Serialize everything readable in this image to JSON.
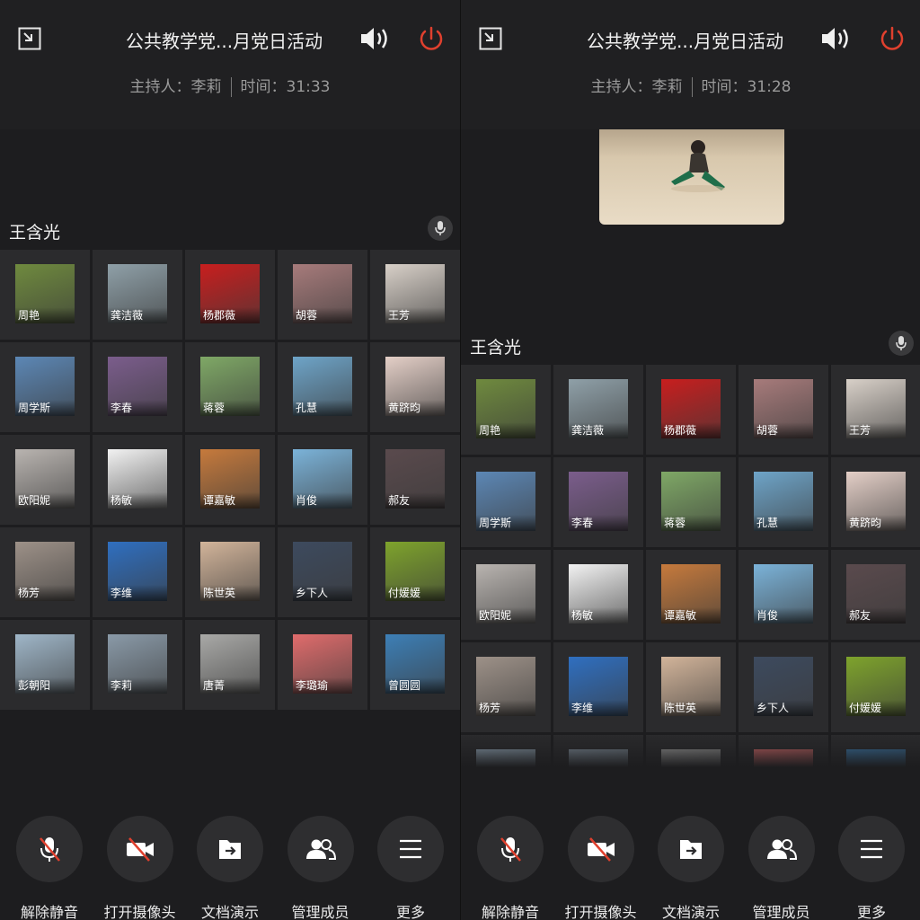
{
  "panels": [
    {
      "title": "公共教学党...月党日活动",
      "host_label": "主持人：李莉",
      "time_label": "时间：31:33",
      "speaker_name": "王含光"
    },
    {
      "title": "公共教学党...月党日活动",
      "host_label": "主持人：李莉",
      "time_label": "时间：31:28",
      "speaker_name": "王含光"
    }
  ],
  "participants": [
    {
      "name": "周艳",
      "bg": "#6f8a3e"
    },
    {
      "name": "龚洁薇",
      "bg": "#8fa0a8"
    },
    {
      "name": "杨郡薇",
      "bg": "#c81e1e"
    },
    {
      "name": "胡蓉",
      "bg": "#a77b7b"
    },
    {
      "name": "王芳",
      "bg": "#d8d0c8"
    },
    {
      "name": "周学斯",
      "bg": "#5c87b5"
    },
    {
      "name": "李春",
      "bg": "#7b5d8c"
    },
    {
      "name": "蒋蓉",
      "bg": "#7fa866"
    },
    {
      "name": "孔慧",
      "bg": "#6ea4c8"
    },
    {
      "name": "黄跻昀",
      "bg": "#e4cfc7"
    },
    {
      "name": "欧阳妮",
      "bg": "#b9b4b0"
    },
    {
      "name": "杨敏",
      "bg": "#f2f2f2"
    },
    {
      "name": "谭嘉敏",
      "bg": "#c67a3c"
    },
    {
      "name": "肖俊",
      "bg": "#7bb3d9"
    },
    {
      "name": "郝友",
      "bg": "#5a4a4d"
    },
    {
      "name": "杨芳",
      "bg": "#9d9188"
    },
    {
      "name": "李维",
      "bg": "#2f6fc0"
    },
    {
      "name": "陈世英",
      "bg": "#d2b49a"
    },
    {
      "name": "乡下人",
      "bg": "#3d4a5e"
    },
    {
      "name": "付媛媛",
      "bg": "#7ea32c"
    },
    {
      "name": "彭朝阳",
      "bg": "#9fb6c8"
    },
    {
      "name": "李莉",
      "bg": "#8a9aa8"
    },
    {
      "name": "唐菁",
      "bg": "#a9a9a7"
    },
    {
      "name": "李璐瑜",
      "bg": "#e06c6c"
    },
    {
      "name": "曾圆圆",
      "bg": "#3d7fb6"
    }
  ],
  "toolbar": [
    {
      "label": "解除静音",
      "icon": "mic-muted-icon"
    },
    {
      "label": "打开摄像头",
      "icon": "camera-off-icon"
    },
    {
      "label": "文档演示",
      "icon": "share-doc-icon"
    },
    {
      "label": "管理成员",
      "icon": "members-icon"
    },
    {
      "label": "更多",
      "icon": "menu-icon"
    }
  ],
  "colors": {
    "accent_red": "#e0402e",
    "background": "#1d1d1f",
    "tile": "#2b2b2d"
  }
}
